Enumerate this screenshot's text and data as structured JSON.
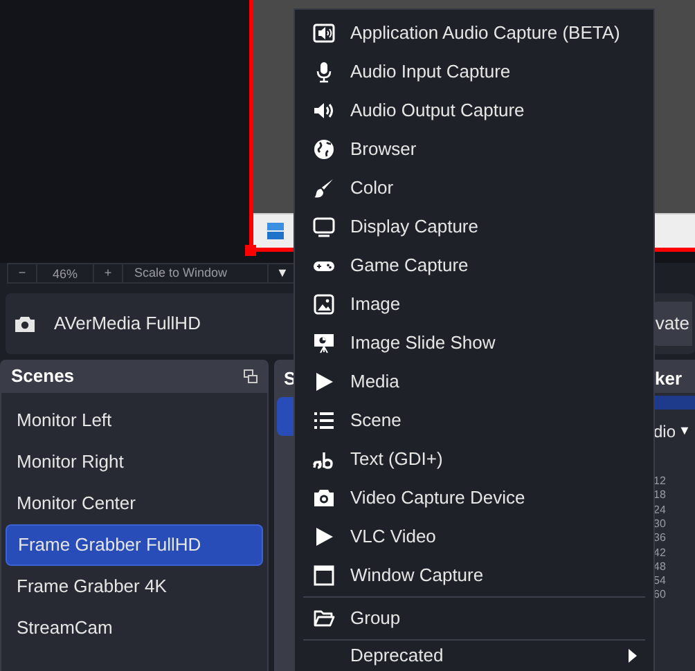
{
  "preview": {
    "zoom_out": "−",
    "zoom": "46%",
    "zoom_in": "+",
    "scale_mode": "Scale to Window",
    "dropdown": "▼"
  },
  "source_bar": {
    "name": "AVerMedia FullHD",
    "button": "vate"
  },
  "scenes": {
    "title": "Scenes",
    "items": [
      {
        "label": "Monitor Left",
        "selected": false
      },
      {
        "label": "Monitor Right",
        "selected": false
      },
      {
        "label": "Monitor Center",
        "selected": false
      },
      {
        "label": "Frame Grabber FullHD",
        "selected": true
      },
      {
        "label": "Frame Grabber 4K",
        "selected": false
      },
      {
        "label": "StreamCam",
        "selected": false
      }
    ]
  },
  "sources": {
    "title": "S"
  },
  "mixer": {
    "title": "ker",
    "device": "dio",
    "dropdown": "▼",
    "ticks": [
      "12",
      "18",
      "24",
      "30",
      "36",
      "42",
      "48",
      "54",
      "60"
    ]
  },
  "menu": {
    "items": [
      {
        "kind": "item",
        "label": "Application Audio Capture (BETA)"
      },
      {
        "kind": "item",
        "label": "Audio Input Capture"
      },
      {
        "kind": "item",
        "label": "Audio Output Capture"
      },
      {
        "kind": "item",
        "label": "Browser"
      },
      {
        "kind": "item",
        "label": "Color"
      },
      {
        "kind": "item",
        "label": "Display Capture"
      },
      {
        "kind": "item",
        "label": "Game Capture"
      },
      {
        "kind": "item",
        "label": "Image"
      },
      {
        "kind": "item",
        "label": "Image Slide Show"
      },
      {
        "kind": "item",
        "label": "Media"
      },
      {
        "kind": "item",
        "label": "Scene"
      },
      {
        "kind": "item",
        "label": "Text (GDI+)"
      },
      {
        "kind": "item",
        "label": "Video Capture Device"
      },
      {
        "kind": "item",
        "label": "VLC Video"
      },
      {
        "kind": "item",
        "label": "Window Capture"
      },
      {
        "kind": "separator"
      },
      {
        "kind": "item",
        "label": "Group"
      },
      {
        "kind": "separator"
      },
      {
        "kind": "submenu",
        "label": "Deprecated"
      }
    ]
  }
}
